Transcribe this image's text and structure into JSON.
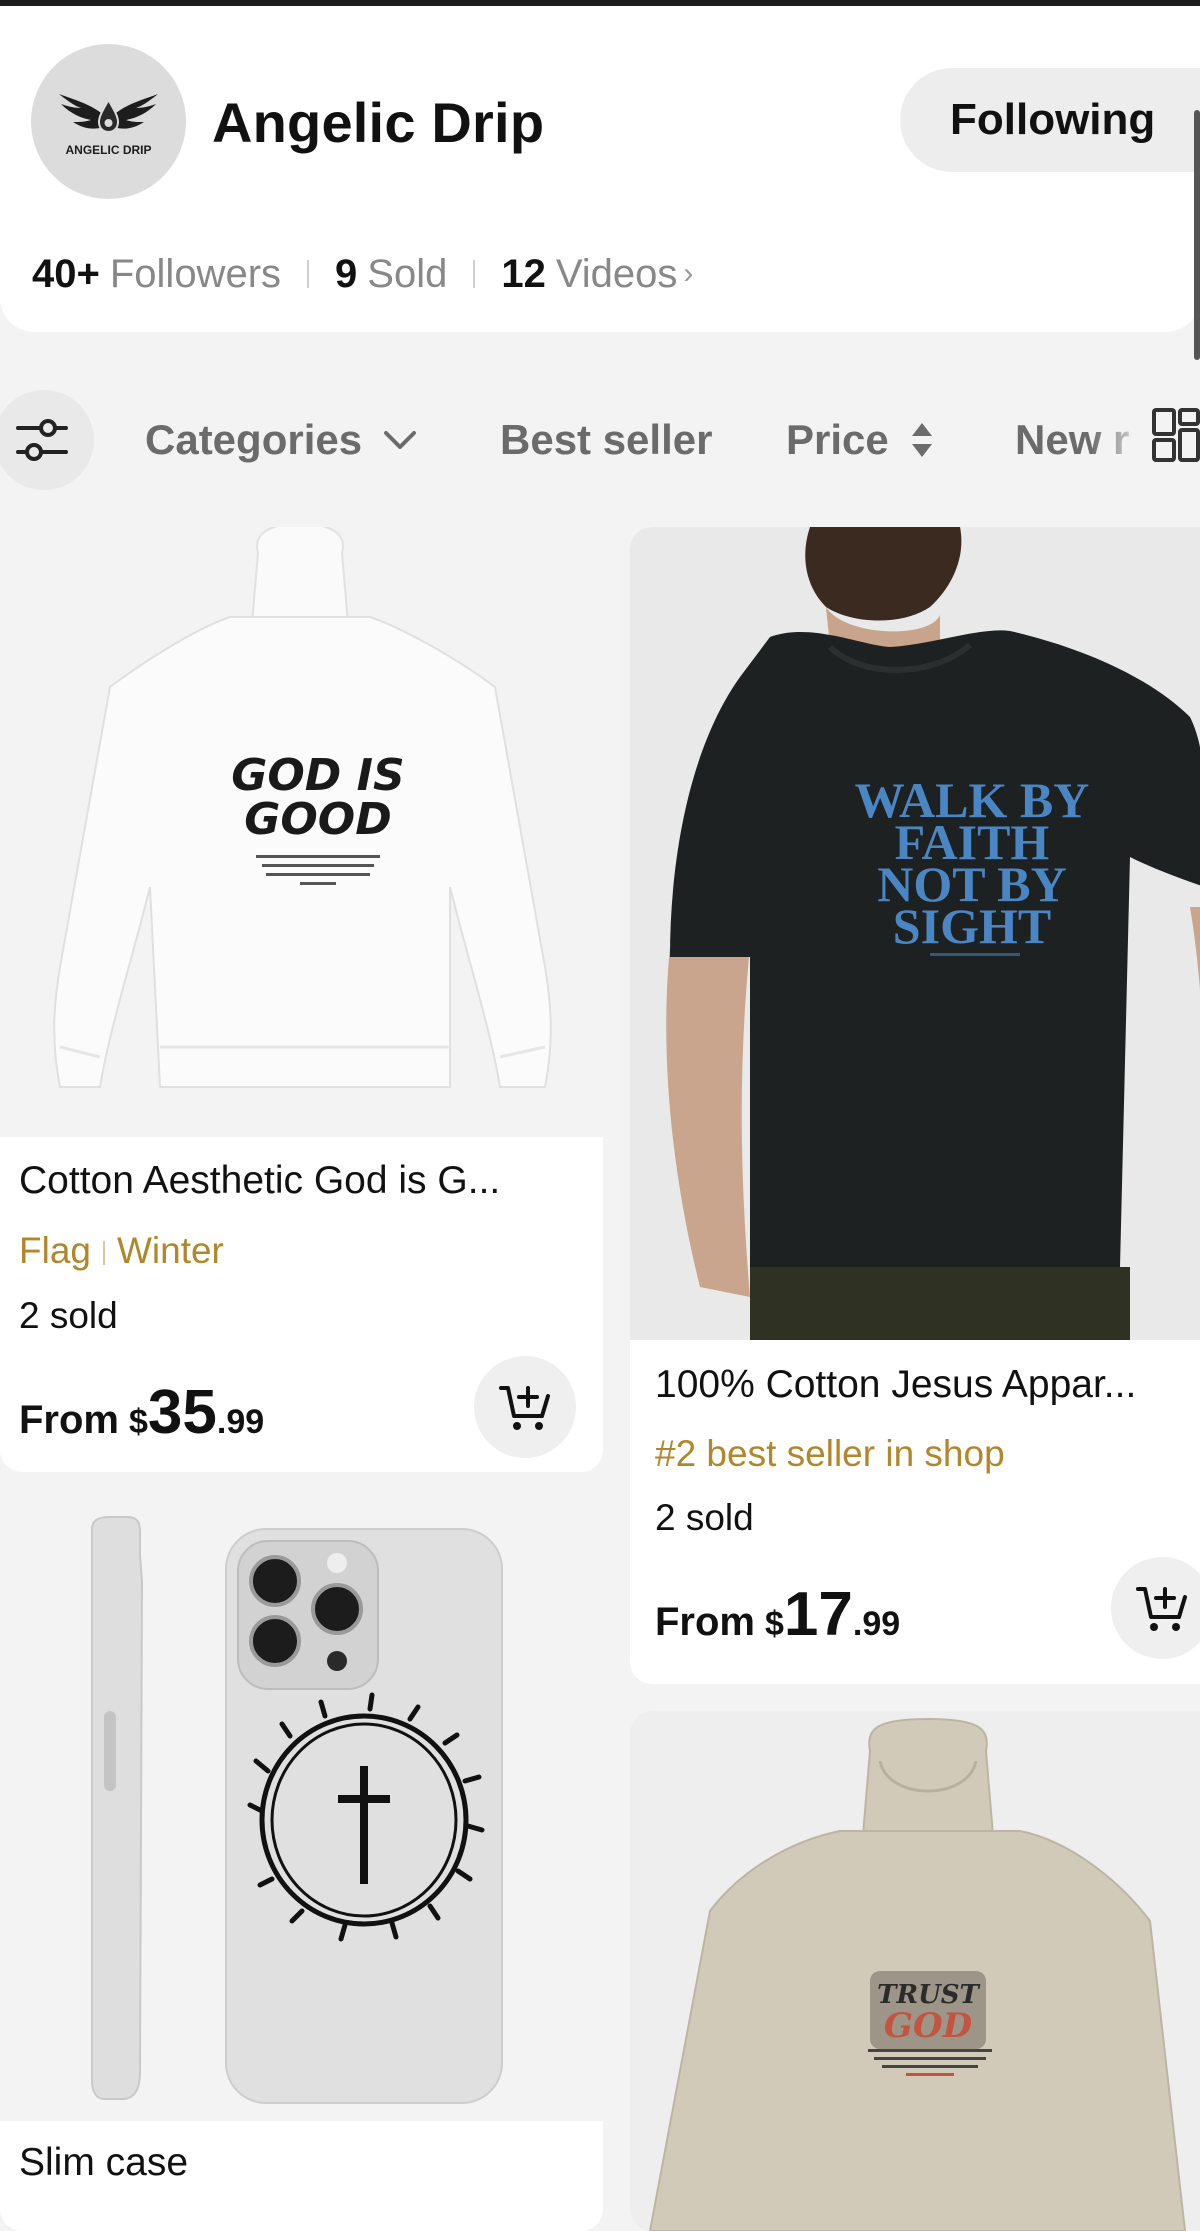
{
  "shop": {
    "name": "Angelic Drip",
    "logo_text": "ANGELIC DRIP",
    "follow_label": "Following",
    "stats": {
      "followers_count": "40+",
      "followers_label": "Followers",
      "sold_count": "9",
      "sold_label": "Sold",
      "videos_count": "12",
      "videos_label": "Videos",
      "videos_chevron": "›"
    }
  },
  "filters": {
    "icon": "sliders-icon",
    "categories": "Categories",
    "best_seller": "Best seller",
    "price": "Price",
    "newest": "New r"
  },
  "products": [
    {
      "title": "Cotton Aesthetic God is G...",
      "tags": [
        "Flag",
        "Winter"
      ],
      "sold": "2 sold",
      "price_prefix": "From",
      "currency": "$",
      "price_whole": "35",
      "price_cents": ".99",
      "print_text": [
        "GOD IS",
        "GOOD"
      ]
    },
    {
      "title": "100% Cotton Jesus Appar...",
      "badge": "#2 best seller in shop",
      "sold": "2 sold",
      "price_prefix": "From",
      "currency": "$",
      "price_whole": "17",
      "price_cents": ".99",
      "print_text": [
        "WALK BY",
        "FAITH",
        "NOT BY",
        "SIGHT"
      ]
    },
    {
      "title": "Slim case"
    },
    {
      "print_text": [
        "TRUST",
        "GOD"
      ]
    }
  ],
  "colors": {
    "accent_tag": "#b2872b",
    "print_blue": "#4b86c4",
    "shirt_black": "#1e2122",
    "hoodie_tan": "#d2cab9"
  }
}
